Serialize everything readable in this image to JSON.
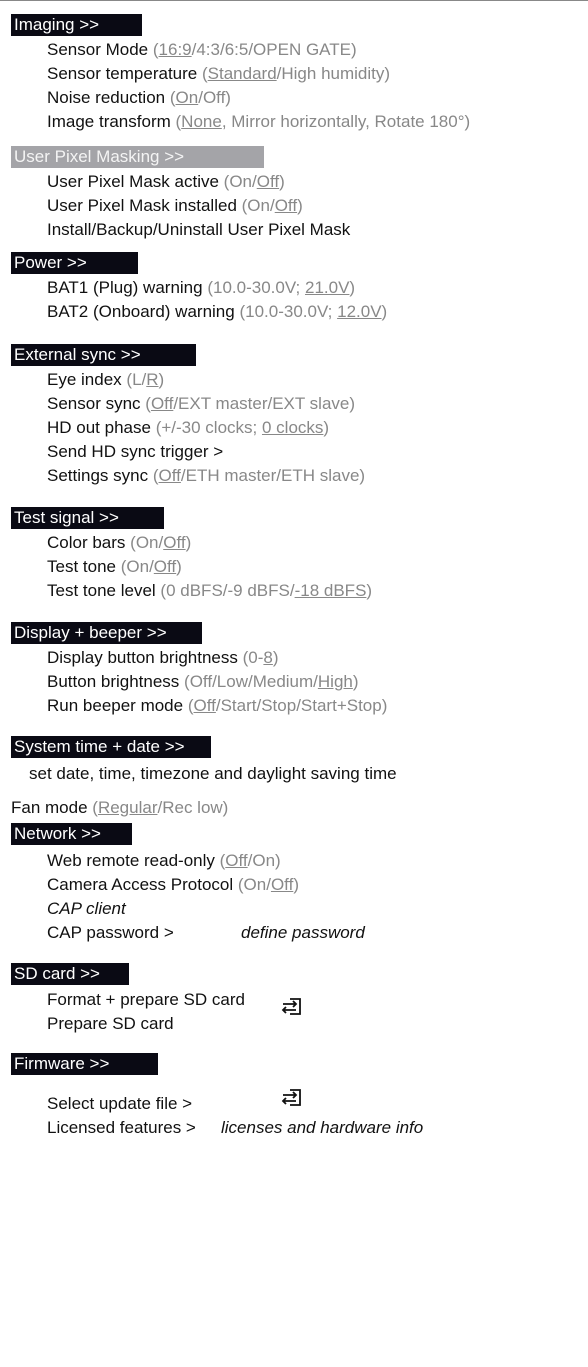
{
  "sections": {
    "imaging": {
      "header": "Imaging >>",
      "sensor_mode": {
        "label": "Sensor Mode",
        "open": "(",
        "sel": "16:9",
        "rest": "/4:3/6:5/OPEN GATE)"
      },
      "sensor_temp": {
        "label": "Sensor temperature",
        "open": "(",
        "sel": "Standard",
        "rest": "/High humidity)"
      },
      "noise": {
        "label": "Noise reduction",
        "open": "(",
        "sel": "On",
        "rest": "/Off)"
      },
      "transform": {
        "label": "Image transform",
        "open": "(",
        "sel": "None",
        "rest": ", Mirror horizontally, Rotate 180°)"
      }
    },
    "upm": {
      "header": "User Pixel Masking  >>",
      "active": {
        "label": "User Pixel Mask active",
        "pre": "(On/",
        "sel": "Off",
        "close": ")"
      },
      "installed": {
        "label": "User Pixel Mask installed",
        "pre": "(On/",
        "sel": "Off",
        "close": ")"
      },
      "install": {
        "label": "Install/Backup/Uninstall User Pixel Mask"
      }
    },
    "power": {
      "header": "Power  >>",
      "bat1": {
        "label": "BAT1 (Plug) warning",
        "pre": "(10.0-30.0V; ",
        "sel": "21.0V",
        "close": ")"
      },
      "bat2": {
        "label": "BAT2 (Onboard) warning",
        "pre": "(10.0-30.0V; ",
        "sel": "12.0V",
        "close": ")"
      }
    },
    "sync": {
      "header": "External sync  >>",
      "eye": {
        "label": "Eye index",
        "pre": "(L/",
        "sel": "R",
        "close": ")"
      },
      "sensor_sync": {
        "label": "Sensor sync",
        "open": "(",
        "sel": "Off",
        "rest": "/EXT master/EXT slave)"
      },
      "hd_phase": {
        "label": "HD out phase",
        "pre": "(+/-30 clocks; ",
        "sel": "0 clocks",
        "close": ")"
      },
      "hd_trigger": {
        "label": "Send HD sync trigger >"
      },
      "settings_sync": {
        "label": "Settings sync",
        "open": "(",
        "sel": "Off",
        "rest": "/ETH master/ETH slave)"
      }
    },
    "test": {
      "header": "Test signal >>",
      "bars": {
        "label": "Color bars",
        "pre": "(On/",
        "sel": "Off",
        "close": ")"
      },
      "tone": {
        "label": "Test tone",
        "pre": "(On/",
        "sel": "Off",
        "close": ")"
      },
      "level": {
        "label": "Test tone level",
        "pre": "(0 dBFS/-9 dBFS/",
        "sel": "-18 dBFS",
        "close": ")"
      }
    },
    "display": {
      "header": "Display + beeper  >>",
      "disp_bright": {
        "label": "Display button brightness",
        "pre": "(0-",
        "sel": "8",
        "close": ")"
      },
      "btn_bright": {
        "label": "Button brightness",
        "pre": "(Off/Low/Medium/",
        "sel": "High",
        "close": ")"
      },
      "beeper": {
        "label": "Run beeper mode",
        "open": "(",
        "sel": "Off",
        "rest": "/Start/Stop/Start+Stop)"
      }
    },
    "time": {
      "header": "System time + date >>",
      "set": {
        "label": "set date, time, timezone and daylight saving time"
      }
    },
    "fan": {
      "label": "Fan mode",
      "open": "(",
      "sel": "Regular",
      "rest": "/Rec low)"
    },
    "network": {
      "header": "Network >>",
      "web": {
        "label": "Web remote read-only",
        "open": "(",
        "sel": "Off",
        "rest": "/On)"
      },
      "cap": {
        "label": "Camera Access Protocol",
        "pre": "(On/",
        "sel": "Off",
        "close": ")"
      },
      "cap_client": "CAP client",
      "cap_pw": {
        "label": "CAP password >",
        "note": "define password"
      }
    },
    "sd": {
      "header": "SD card >>",
      "format": {
        "label": "Format + prepare SD card"
      },
      "prepare": {
        "label": "Prepare SD card"
      }
    },
    "firmware": {
      "header": "Firmware  >>",
      "update": {
        "label": "Select update file >"
      },
      "licensed": {
        "label": "Licensed features >",
        "note": "licenses and hardware info"
      }
    }
  },
  "icons": {
    "transfer": "transfer-arrows-icon"
  }
}
